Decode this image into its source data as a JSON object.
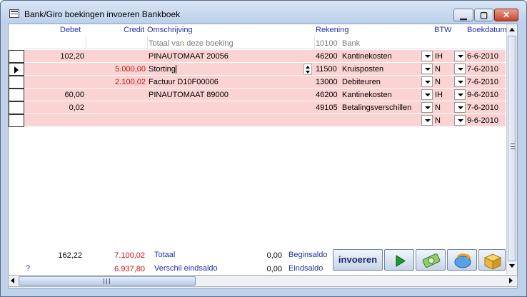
{
  "window": {
    "title": "Bank/Giro boekingen invoeren Bankboek"
  },
  "columns": {
    "debet": "Debet",
    "credit": "Credit",
    "omschrijving": "Omschrijving",
    "rekening": "Rekening",
    "btw": "BTW",
    "boekdatum": "Boekdatum"
  },
  "summary_row": {
    "omschrijving": "Totaal van deze boeking",
    "rekening_nr": "10100",
    "rekening_naam": "Bank"
  },
  "rows": [
    {
      "debet": "102,20",
      "credit": "",
      "omschrijving": "PINAUTOMAAT 20056",
      "rekening_nr": "46200",
      "rekening_naam": "Kantinekosten",
      "btw": "IH",
      "datum": "6-6-2010"
    },
    {
      "debet": "",
      "credit": "5.000,00",
      "omschrijving": "Storting",
      "rekening_nr": "11500",
      "rekening_naam": "Kruisposten",
      "btw": "N",
      "datum": "7-6-2010"
    },
    {
      "debet": "",
      "credit": "2.100,02",
      "omschrijving": "Factuur D10F00006",
      "rekening_nr": "13000",
      "rekening_naam": "Debiteuren",
      "btw": "N",
      "datum": "7-6-2010"
    },
    {
      "debet": "60,00",
      "credit": "",
      "omschrijving": "PINAUTOMAAT 89000",
      "rekening_nr": "46200",
      "rekening_naam": "Kantinekosten",
      "btw": "IH",
      "datum": "9-6-2010"
    },
    {
      "debet": "0,02",
      "credit": "",
      "omschrijving": "",
      "rekening_nr": "49105",
      "rekening_naam": "Betalingsverschillen",
      "btw": "N",
      "datum": "7-6-2010"
    },
    {
      "debet": "",
      "credit": "",
      "omschrijving": "",
      "rekening_nr": "",
      "rekening_naam": "",
      "btw": "N",
      "datum": "9-6-2010"
    }
  ],
  "footer": {
    "totaal_debet": "162,22",
    "totaal_credit": "7.100,02",
    "totaal_label": "Totaal",
    "beginsaldo_value": "0,00",
    "beginsaldo_label": "Beginsaldo",
    "question": "?",
    "verschil_value": "6.937,80",
    "verschil_label": "Verschil eindsaldo",
    "eindsaldo_value": "0,00",
    "eindsaldo_label": "Eindsaldo"
  },
  "toolbar": {
    "invoeren_label": "invoeren",
    "play_icon": "play-icon",
    "money_icon": "money-icon",
    "refresh_icon": "refresh-icon",
    "box_icon": "box-icon"
  },
  "colors": {
    "row_bg": "#fbd3d3",
    "header_text": "#2030a8",
    "credit_text": "#cc1010"
  }
}
